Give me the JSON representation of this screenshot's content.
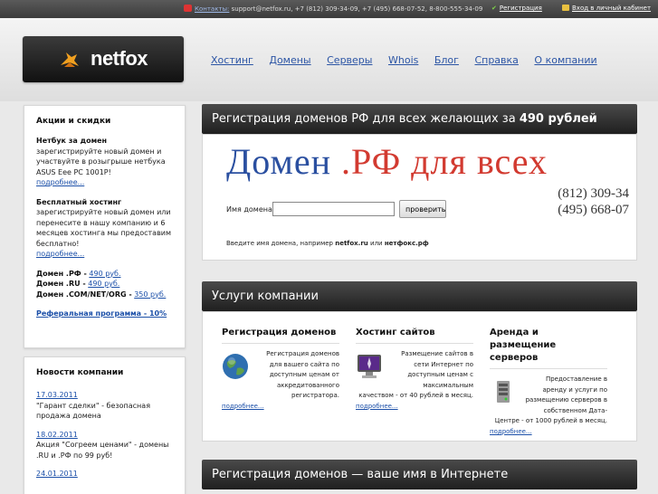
{
  "topbar": {
    "contacts_label": "Контакты:",
    "contacts_text": "support@netfox.ru, +7 (812) 309-34-09, +7 (495) 668-07-52, 8-800-555-34-09",
    "register_link": "Регистрация",
    "login_link": "Вход в личный кабинет"
  },
  "header": {
    "logo_text": "netfox",
    "nav": [
      "Хостинг",
      "Домены",
      "Серверы",
      "Whois",
      "Блог",
      "Справка",
      "О компании"
    ]
  },
  "promo": {
    "title": "Акции и скидки",
    "netbook_head": "Нетбук за домен",
    "netbook_text": "зарегистрируйте новый домен и участвуйте в розыгрыше нетбука ASUS Eee PC 1001P!",
    "netbook_more": "подробнее...",
    "hosting_head": "Бесплатный хостинг",
    "hosting_text": "зарегистрируйте новый домен или перенесите в нашу компанию и 6 месяцев хостинга мы предоставим бесплатно!",
    "hosting_more": "подробнее...",
    "rf_label": "Домен .РФ -",
    "rf_price": "490 руб.",
    "ru_label": "Домен .RU -",
    "ru_price": "490 руб.",
    "com_label": "Домен .COM/NET/ORG -",
    "com_price": "350 руб.",
    "referral": "Реферальная программа - 10%"
  },
  "news": {
    "title": "Новости компании",
    "items": [
      {
        "date": "17.03.2011",
        "text": "\"Гарант сделки\" - безопасная продажа домена"
      },
      {
        "date": "18.02.2011",
        "text": "Акция \"Согреем ценами\" - домены .RU и .РФ по 99 руб!"
      },
      {
        "date": "24.01.2011",
        "text": ""
      }
    ]
  },
  "domain_panel": {
    "title_prefix": "Регистрация доменов РФ для всех желающих за",
    "title_price": "490 рублей",
    "banner_part1": "Домен",
    "banner_part2": ".РФ для всех",
    "phone1": "(812) 309-34",
    "phone2": "(495) 668-07",
    "label": "Имя домена:",
    "input_value": "",
    "button": "проверить",
    "hint_prefix": "Введите имя домена, например",
    "hint_ex1": "netfox.ru",
    "hint_or": "или",
    "hint_ex2": "нетфокс.рф"
  },
  "services": {
    "title": "Услуги компании",
    "items": [
      {
        "title": "Регистрация доменов",
        "text": "Регистрация доменов для вашего сайта по доступным ценам от аккредитованного регистратора.",
        "more": "подробнее...",
        "icon": "globe-icon"
      },
      {
        "title": "Хостинг сайтов",
        "text": "Размещение сайтов в сети Интернет по доступным ценам с максимальным качеством - от 40 рублей в месяц.",
        "more": "подробнее...",
        "icon": "monitor-icon"
      },
      {
        "title": "Аренда и размещение серверов",
        "text": "Предоставление в аренду и услуги по размещению серверов в собственном Дата-Центре - от 1000 рублей в месяц.",
        "more": "подробнее...",
        "icon": "server-icon"
      }
    ]
  },
  "bottom_panel": {
    "title": "Регистрация доменов — ваше имя в Интернете"
  }
}
